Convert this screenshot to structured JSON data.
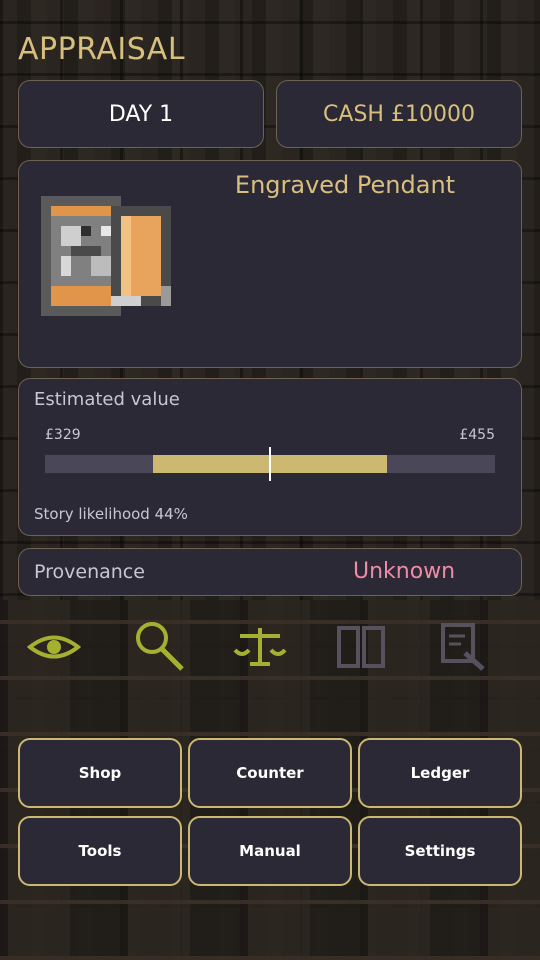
{
  "header": {
    "title": "APPRAISAL"
  },
  "status": {
    "day": "DAY 1",
    "cash": "CASH £10000"
  },
  "item": {
    "name": "Engraved Pendant",
    "sprite_icon": "pendant-icon"
  },
  "estimate": {
    "label": "Estimated value",
    "min_label": "£329",
    "max_label": "£455",
    "range_fill_start": 0.24,
    "range_fill_end": 0.76,
    "marker_position": 0.5,
    "story": "Story likelihood 44%"
  },
  "provenance": {
    "label": "Provenance",
    "value": "Unknown",
    "value_color": "#f08aa6"
  },
  "tools": [
    {
      "icon": "eye-icon",
      "color": "#a4b032"
    },
    {
      "icon": "magnifier-icon",
      "color": "#a4b032"
    },
    {
      "icon": "scales-icon",
      "color": "#a4b032"
    },
    {
      "icon": "book-icon",
      "color": "#55525e"
    },
    {
      "icon": "document-search-icon",
      "color": "#55525e"
    }
  ],
  "menu": {
    "shop": "Shop",
    "counter": "Counter",
    "ledger": "Ledger",
    "tools": "Tools",
    "manual": "Manual",
    "settings": "Settings"
  },
  "colors": {
    "accent": "#d8bf7e",
    "panel": "#2b2935",
    "button_border": "#cdb871"
  }
}
